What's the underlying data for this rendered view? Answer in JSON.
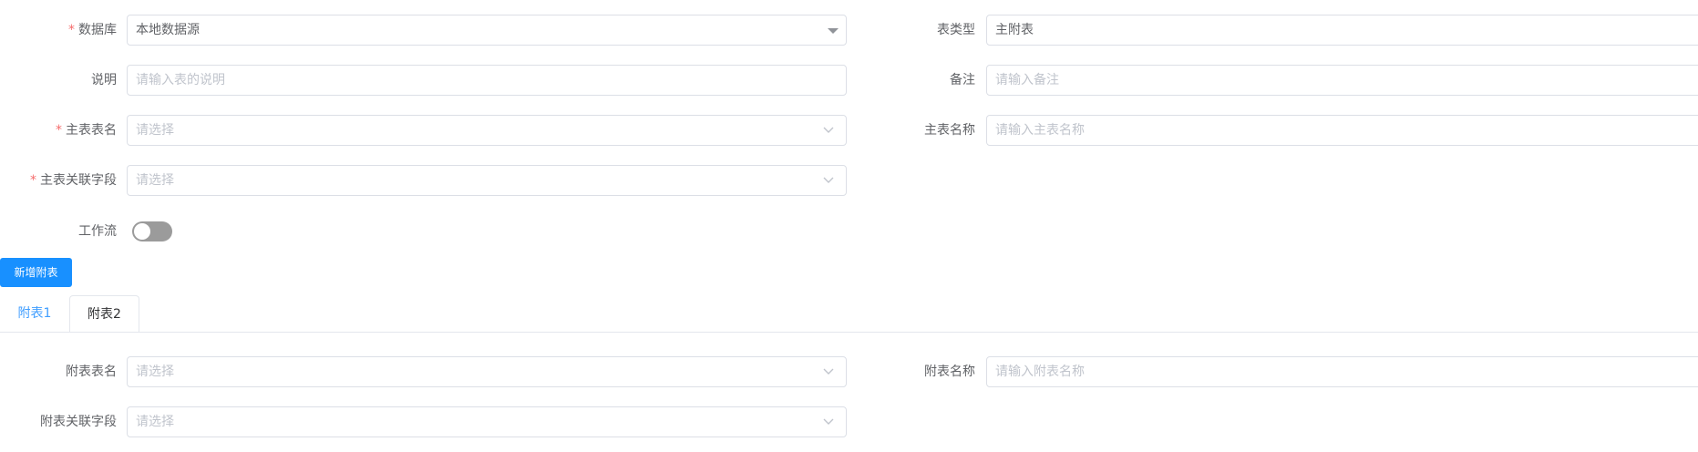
{
  "form": {
    "database": {
      "label": "数据库",
      "required": true,
      "value": "本地数据源"
    },
    "table_type": {
      "label": "表类型",
      "value": "主附表"
    },
    "description": {
      "label": "说明",
      "placeholder": "请输入表的说明"
    },
    "remark": {
      "label": "备注",
      "placeholder": "请输入备注"
    },
    "main_table": {
      "label": "主表表名",
      "required": true,
      "placeholder": "请选择"
    },
    "main_table_name": {
      "label": "主表名称",
      "placeholder": "请输入主表名称"
    },
    "main_link_field": {
      "label": "主表关联字段",
      "required": true,
      "placeholder": "请选择"
    },
    "workflow": {
      "label": "工作流",
      "enabled": false
    }
  },
  "actions": {
    "add_sub_table": "新增附表"
  },
  "tabs": [
    {
      "label": "附表1",
      "active": true
    },
    {
      "label": "附表2",
      "active": false
    }
  ],
  "sub_form": {
    "sub_table": {
      "label": "附表表名",
      "placeholder": "请选择"
    },
    "sub_table_name": {
      "label": "附表名称",
      "placeholder": "请输入附表名称"
    },
    "sub_link_field": {
      "label": "附表关联字段",
      "placeholder": "请选择"
    }
  },
  "colors": {
    "primary": "#1890ff",
    "active_tab": "#409eff",
    "required_mark": "#f56c6c",
    "switch_off": "#9b9b9b"
  }
}
